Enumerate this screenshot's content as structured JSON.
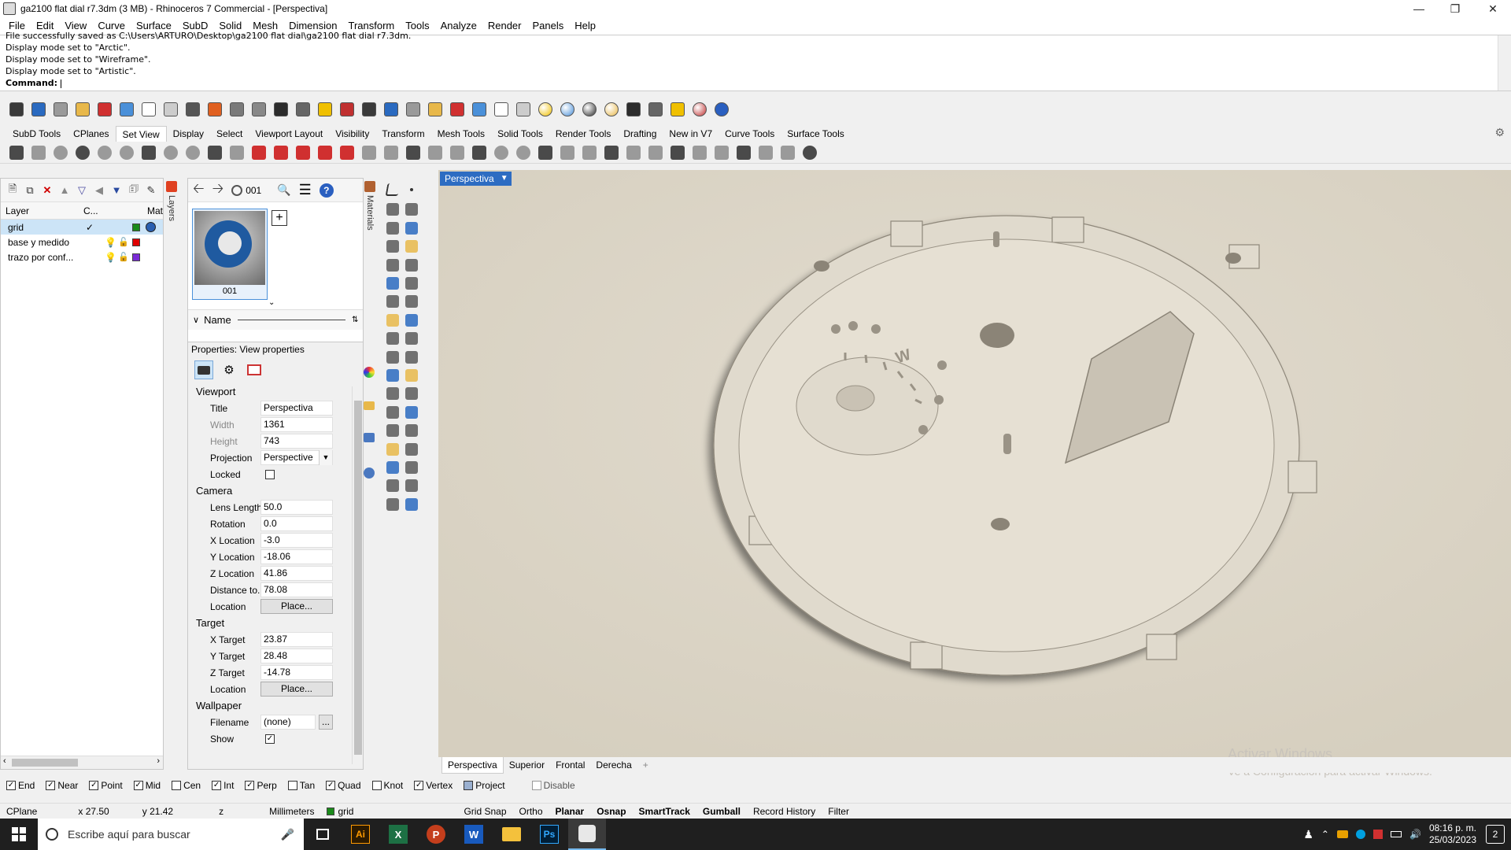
{
  "window": {
    "title": "ga2100 flat dial r7.3dm (3 MB) - Rhinoceros 7 Commercial - [Perspectiva]"
  },
  "menu": [
    "File",
    "Edit",
    "View",
    "Curve",
    "Surface",
    "SubD",
    "Solid",
    "Mesh",
    "Dimension",
    "Transform",
    "Tools",
    "Analyze",
    "Render",
    "Panels",
    "Help"
  ],
  "command_history": {
    "lines": [
      "File successfully saved as C:\\Users\\ARTURO\\Desktop\\ga2100 flat dial\\ga2100 flat dial r7.3dm.",
      "Display mode set to \"Arctic\".",
      "Display mode set to \"Wireframe\".",
      "Display mode set to \"Artistic\"."
    ],
    "prompt": "Command:"
  },
  "toolbar_tabs": [
    "SubD Tools",
    "CPlanes",
    "Set View",
    "Display",
    "Select",
    "Viewport Layout",
    "Visibility",
    "Transform",
    "Mesh Tools",
    "Solid Tools",
    "Render Tools",
    "Drafting",
    "New in V7",
    "Curve Tools",
    "Surface Tools"
  ],
  "active_tab": "Set View",
  "layers": {
    "tab_label": "Layers",
    "headers": {
      "layer": "Layer",
      "current": "C...",
      "material": "Mat"
    },
    "rows": [
      {
        "name": "grid",
        "color": "#1a8a1a",
        "current": true
      },
      {
        "name": "base y medido",
        "color": "#e00000",
        "current": false
      },
      {
        "name": "trazo por conf...",
        "color": "#7a2bd6",
        "current": false
      }
    ]
  },
  "materials_tab": "Materials",
  "named_views": {
    "nav_field": "001",
    "thumb_label": "001",
    "name_header": "Name"
  },
  "properties": {
    "header": "Properties: View properties",
    "viewport_section": "Viewport",
    "title_label": "Title",
    "title_value": "Perspectiva",
    "width_label": "Width",
    "width_value": "1361",
    "height_label": "Height",
    "height_value": "743",
    "projection_label": "Projection",
    "projection_value": "Perspective",
    "locked_label": "Locked",
    "camera_section": "Camera",
    "lens_label": "Lens Length",
    "lens_value": "50.0",
    "rotation_label": "Rotation",
    "rotation_value": "0.0",
    "xloc_label": "X Location",
    "xloc_value": "-3.0",
    "yloc_label": "Y Location",
    "yloc_value": "-18.06",
    "zloc_label": "Z Location",
    "zloc_value": "41.86",
    "dist_label": "Distance to...",
    "dist_value": "78.08",
    "location_label": "Location",
    "place_button": "Place...",
    "target_section": "Target",
    "xt_label": "X Target",
    "xt_value": "23.87",
    "yt_label": "Y Target",
    "yt_value": "28.48",
    "zt_label": "Z Target",
    "zt_value": "-14.78",
    "tlocation_label": "Location",
    "tplace_button": "Place...",
    "wallpaper_section": "Wallpaper",
    "filename_label": "Filename",
    "filename_value": "(none)",
    "filename_btn": "...",
    "show_label": "Show"
  },
  "viewport": {
    "title": "Perspectiva",
    "tabs": [
      "Perspectiva",
      "Superior",
      "Frontal",
      "Derecha"
    ],
    "add_tab": "+",
    "dial_letter": "W"
  },
  "watermark": {
    "line1": "Activar Windows",
    "line2": "Ve a Configuración para activar Windows."
  },
  "osnaps": [
    {
      "label": "End",
      "checked": true
    },
    {
      "label": "Near",
      "checked": true
    },
    {
      "label": "Point",
      "checked": true
    },
    {
      "label": "Mid",
      "checked": true
    },
    {
      "label": "Cen",
      "checked": false
    },
    {
      "label": "Int",
      "checked": true
    },
    {
      "label": "Perp",
      "checked": true
    },
    {
      "label": "Tan",
      "checked": false
    },
    {
      "label": "Quad",
      "checked": true
    },
    {
      "label": "Knot",
      "checked": false
    },
    {
      "label": "Vertex",
      "checked": true
    },
    {
      "label": "Project",
      "checked": false
    },
    {
      "label": "Disable",
      "checked": false
    }
  ],
  "status": {
    "cplane": "CPlane",
    "x": "x 27.50",
    "y": "y 21.42",
    "z": "z",
    "units": "Millimeters",
    "layer": "grid",
    "layer_color": "#1a8a1a",
    "toggles": [
      {
        "label": "Grid Snap",
        "on": false
      },
      {
        "label": "Ortho",
        "on": false
      },
      {
        "label": "Planar",
        "on": true
      },
      {
        "label": "Osnap",
        "on": true
      },
      {
        "label": "SmartTrack",
        "on": true
      },
      {
        "label": "Gumball",
        "on": true
      },
      {
        "label": "Record History",
        "on": false
      },
      {
        "label": "Filter",
        "on": false
      }
    ]
  },
  "taskbar": {
    "search_placeholder": "Escribe aquí para buscar",
    "time": "08:16 p. m.",
    "date": "25/03/2023",
    "notification_count": "2"
  }
}
